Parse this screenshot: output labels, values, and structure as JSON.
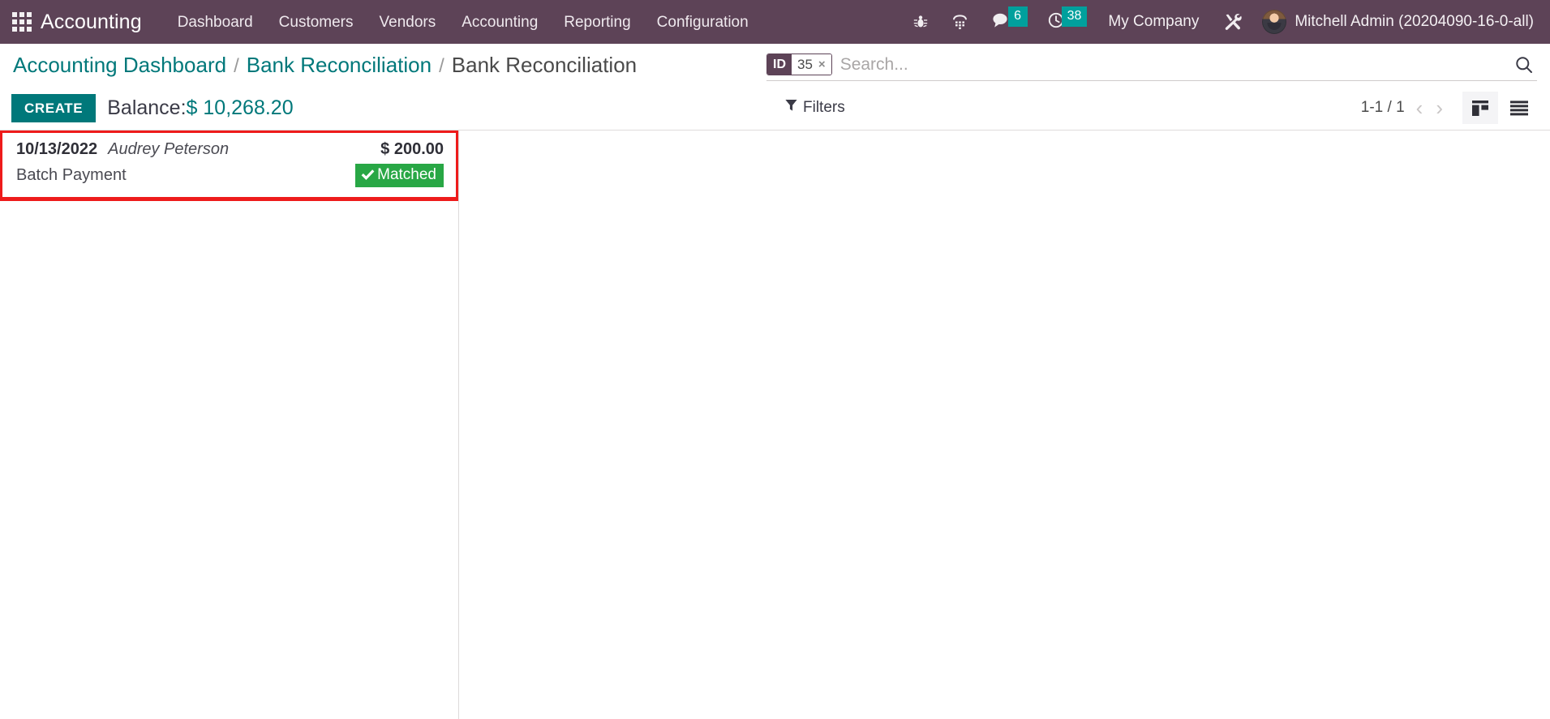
{
  "navbar": {
    "apps_icon": "apps-grid-icon",
    "brand": "Accounting",
    "menu_items": [
      {
        "label": "Dashboard"
      },
      {
        "label": "Customers"
      },
      {
        "label": "Vendors"
      },
      {
        "label": "Accounting"
      },
      {
        "label": "Reporting"
      },
      {
        "label": "Configuration"
      }
    ],
    "system_icons": [
      {
        "name": "bug-icon"
      },
      {
        "name": "dialpad-icon"
      }
    ],
    "messages": {
      "icon": "chat-bubble-icon",
      "count": "6"
    },
    "activities": {
      "icon": "clock-icon",
      "count": "38"
    },
    "company": "My Company",
    "debug_icon": "wrench-screwdriver-icon",
    "user": {
      "avatar": "user-avatar",
      "name": "Mitchell Admin (20204090-16-0-all)"
    }
  },
  "control_panel": {
    "breadcrumb": [
      {
        "label": "Accounting Dashboard",
        "active": false
      },
      {
        "label": "Bank Reconciliation",
        "active": false
      },
      {
        "label": "Bank Reconciliation",
        "active": true
      }
    ],
    "breadcrumb_separator": "/",
    "search": {
      "facet_label": "ID",
      "facet_value": "35",
      "facet_remove": "×",
      "placeholder": "Search...",
      "value": "",
      "search_icon": "magnifier-icon"
    },
    "create_label": "CREATE",
    "balance_label": "Balance:",
    "balance_value": "$ 10,268.20",
    "filters_label": "Filters",
    "filters_icon": "funnel-icon",
    "pager": {
      "range": "1-1 / 1",
      "prev_icon": "chevron-left-icon",
      "next_icon": "chevron-right-icon"
    },
    "views": [
      {
        "name": "kanban-view",
        "icon": "kanban-icon",
        "active": true
      },
      {
        "name": "list-view",
        "icon": "list-icon",
        "active": false
      }
    ]
  },
  "records": [
    {
      "date": "10/13/2022",
      "partner": "Audrey Peterson",
      "label": "Batch Payment",
      "amount": "$ 200.00",
      "status": "Matched",
      "status_icon": "check-icon",
      "highlighted": true
    }
  ],
  "colors": {
    "navbar_bg": "#5D4357",
    "accent_teal": "#00787A",
    "badge_teal": "#00A09D",
    "status_green": "#28A745",
    "highlight_red": "#EE1B1B",
    "text_dark": "#3B3B47"
  }
}
